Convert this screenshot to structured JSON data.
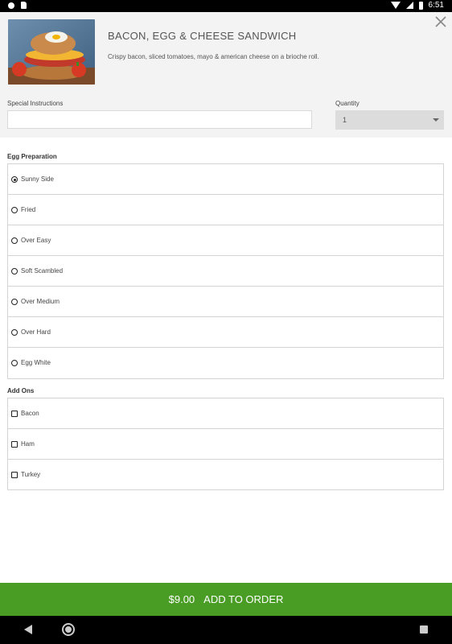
{
  "status_bar": {
    "time": "6:51"
  },
  "item": {
    "title": "BACON, EGG & CHEESE SANDWICH",
    "description": "Crispy bacon, sliced tomatoes, mayo & american cheese on a brioche roll."
  },
  "form": {
    "instructions_label": "Special Instructions",
    "instructions_value": "",
    "quantity_label": "Quantity",
    "quantity_value": "1"
  },
  "egg_preparation": {
    "label": "Egg Preparation",
    "selected": "Sunny Side",
    "options": [
      "Sunny Side",
      "Fried",
      "Over Easy",
      "Soft Scambled",
      "Over Medium",
      "Over Hard",
      "Egg White"
    ]
  },
  "add_ons": {
    "label": "Add Ons",
    "options": [
      "Bacon",
      "Ham",
      "Turkey"
    ]
  },
  "order_button": {
    "price": "$9.00",
    "label": "ADD TO ORDER",
    "color": "#4a9d24"
  },
  "icons": {
    "close": "close-icon",
    "back": "nav-back-icon",
    "home": "nav-home-icon",
    "recents": "nav-recents-icon"
  }
}
